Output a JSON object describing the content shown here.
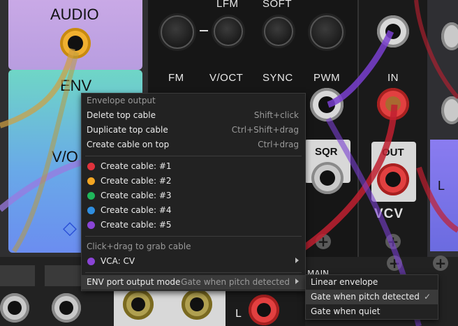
{
  "modules": {
    "left": {
      "audio_label": "AUDIO",
      "env_label": "ENV",
      "voct_label": "V/O"
    },
    "vco": {
      "top_labels": [
        "LFM",
        "SOFT"
      ],
      "fm_label": "FM",
      "voct_label": "V/OCT",
      "sync_label": "SYNC",
      "pwm_label": "PWM",
      "sqr_label": "SQR"
    },
    "output": {
      "in_label": "IN",
      "out_label": "OUT",
      "brand": "VCV"
    },
    "right": {
      "l_label": "L"
    },
    "bottom": {
      "l_label": "L",
      "partial_label": "MAIN"
    }
  },
  "context_menu": {
    "header": "Envelope output",
    "items": [
      {
        "label": "Delete top cable",
        "shortcut": "Shift+click"
      },
      {
        "label": "Duplicate top cable",
        "shortcut": "Ctrl+Shift+drag"
      },
      {
        "label": "Create cable on top",
        "shortcut": "Ctrl+drag"
      }
    ],
    "cable_items": [
      {
        "label": "Create cable: #1",
        "color": "#e0323c"
      },
      {
        "label": "Create cable: #2",
        "color": "#f4a623"
      },
      {
        "label": "Create cable: #3",
        "color": "#1fb75b"
      },
      {
        "label": "Create cable: #4",
        "color": "#2f8ee0"
      },
      {
        "label": "Create cable: #5",
        "color": "#8a44d6"
      }
    ],
    "grab_hint": "Click+drag to grab cable",
    "connected": {
      "label": "VCA: CV",
      "color": "#8a44d6"
    },
    "port_mode": {
      "label": "ENV port output mode",
      "value": "Gate when pitch detected"
    }
  },
  "submenu": {
    "items": [
      {
        "label": "Linear envelope",
        "checked": ""
      },
      {
        "label": "Gate when pitch detected",
        "checked": "✓"
      },
      {
        "label": "Gate when quiet",
        "checked": ""
      }
    ]
  }
}
